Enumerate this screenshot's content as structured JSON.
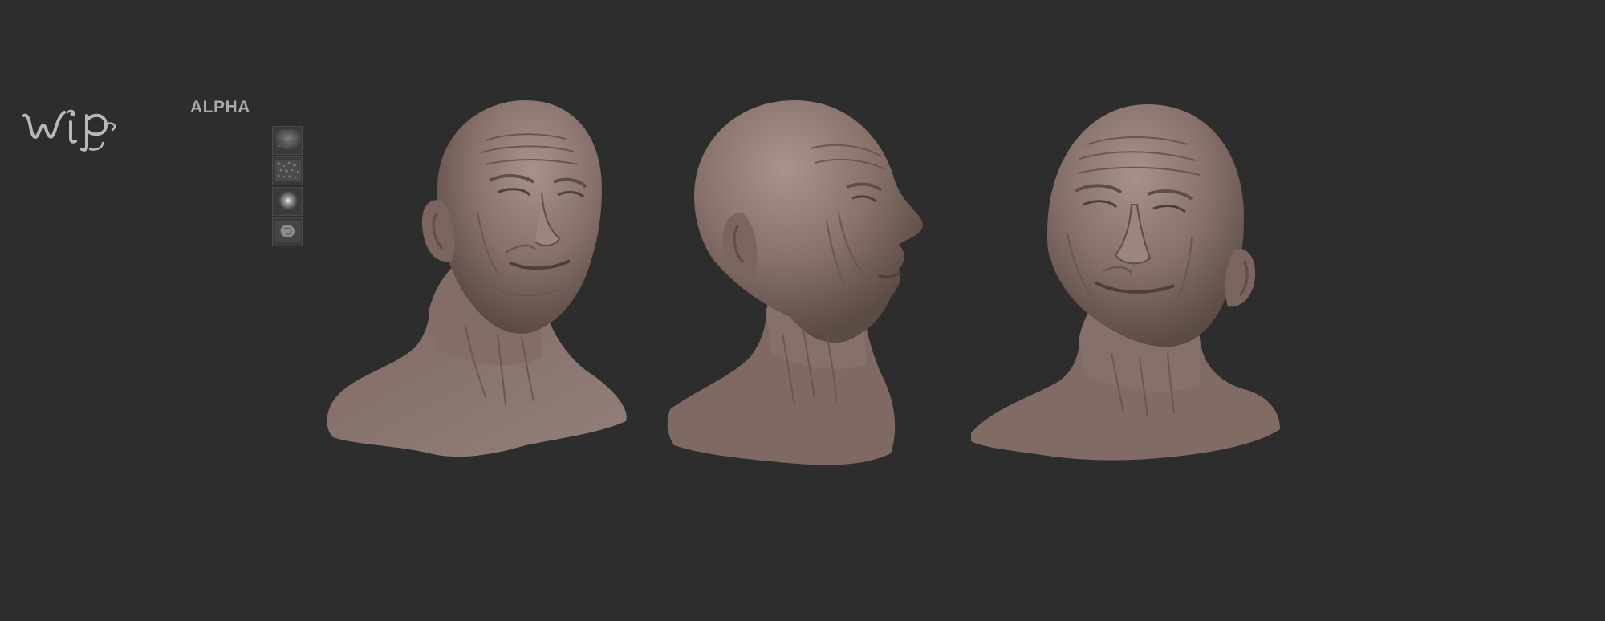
{
  "header": {
    "logo_text": "Wip",
    "alpha_title": "ALPHA"
  },
  "alpha_panel": {
    "thumbnails": [
      {
        "label": "",
        "icon": "skin-pores-alpha-icon"
      },
      {
        "label": "",
        "icon": "wrinkle-noise-alpha-icon"
      },
      {
        "label": "",
        "icon": "radial-gradient-alpha-icon"
      },
      {
        "label": "",
        "icon": "detail-stamp-alpha-icon"
      }
    ]
  },
  "views": [
    {
      "name": "front-three-quarter-view"
    },
    {
      "name": "side-profile-view"
    },
    {
      "name": "tilted-three-quarter-view"
    }
  ],
  "colors": {
    "background": "#2d2d2d",
    "clay": "#8a756a",
    "clay_light": "#a6928a",
    "clay_dark": "#5e4e46",
    "label": "#a9a9a9"
  }
}
